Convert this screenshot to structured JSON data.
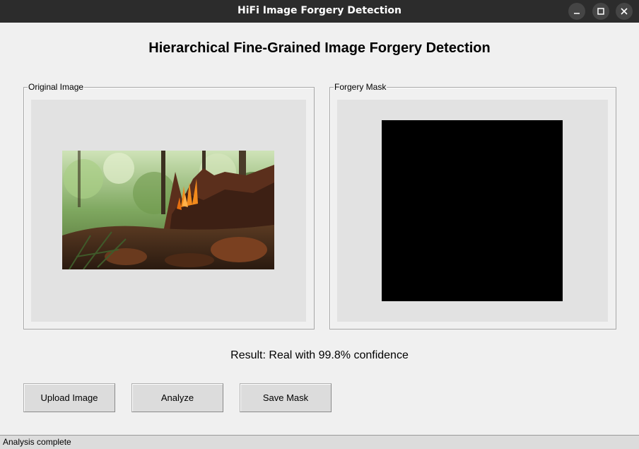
{
  "window": {
    "title": "HiFi Image Forgery Detection"
  },
  "main": {
    "heading": "Hierarchical Fine-Grained Image Forgery Detection",
    "original_frame_label": "Original Image",
    "mask_frame_label": "Forgery Mask",
    "result_text": "Result: Real with 99.8% confidence"
  },
  "buttons": {
    "upload": "Upload Image",
    "analyze": "Analyze",
    "save_mask": "Save Mask"
  },
  "status": {
    "text": "Analysis complete"
  },
  "icons": {
    "minimize": "minimize-icon",
    "maximize": "maximize-icon",
    "close": "close-icon"
  },
  "colors": {
    "titlebar": "#2c2c2c",
    "background": "#f0f0f0",
    "canvas": "#e2e2e2",
    "mask": "#000000"
  }
}
